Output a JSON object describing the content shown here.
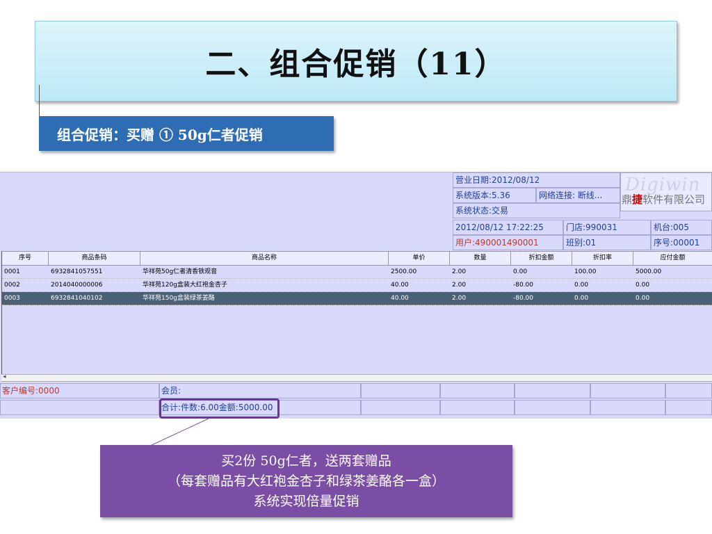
{
  "slide": {
    "title": "二、组合促销（11）",
    "subtitle": "组合促销：买赠 ① 50g仁者促销",
    "callout_lines": [
      "买2份 50g仁者，送两套赠品",
      "（每套赠品有大红袍金杏子和绿茶姜酪各一盒）",
      "系统实现倍量促销"
    ]
  },
  "pos": {
    "info": {
      "business_date": "营业日期:2012/08/12",
      "version": "系统版本:5.36",
      "network": "网络连接: 断线...",
      "status": "系统状态:交易",
      "datetime": "2012/08/12 17:22:25",
      "store": "门店:990031",
      "machine": "机台:005",
      "user": "用户:490001490001",
      "shift": "班别:01",
      "serial": "序号:00001"
    },
    "logo": {
      "script_text": "Digiwin",
      "company_prefix": "鼎",
      "company_highlight": "捷",
      "company_suffix": "软件有限公司"
    },
    "columns": [
      "序号",
      "商品条码",
      "商品名称",
      "单价",
      "数量",
      "折扣金额",
      "折扣率",
      "应付金额"
    ],
    "rows": [
      {
        "seq": "0001",
        "barcode": "6932841057551",
        "name": "华祥苑50g仁者清香铁观音",
        "price": "2500.00",
        "qty": "2.00",
        "discount": "0.00",
        "rate": "100.00",
        "payable": "5000.00"
      },
      {
        "seq": "0002",
        "barcode": "2014040000006",
        "name": "华祥苑120g盒装大红袍金杏子",
        "price": "40.00",
        "qty": "2.00",
        "discount": "-80.00",
        "rate": "0.00",
        "payable": "0.00"
      },
      {
        "seq": "0003",
        "barcode": "6932841040102",
        "name": "华祥苑150g盒装绿茶姜酪",
        "price": "40.00",
        "qty": "2.00",
        "discount": "-80.00",
        "rate": "0.00",
        "payable": "0.00"
      }
    ],
    "selected_row": 2,
    "footer": {
      "customer": "客户编号:0000",
      "member": "会员:",
      "total": "合计:件数:6.00金额:5000.00"
    }
  },
  "colors": {
    "accent": "#2e6db4",
    "callout": "#7b4ea6",
    "highlight": "#7030a0",
    "selected_row": "#4a6176"
  }
}
